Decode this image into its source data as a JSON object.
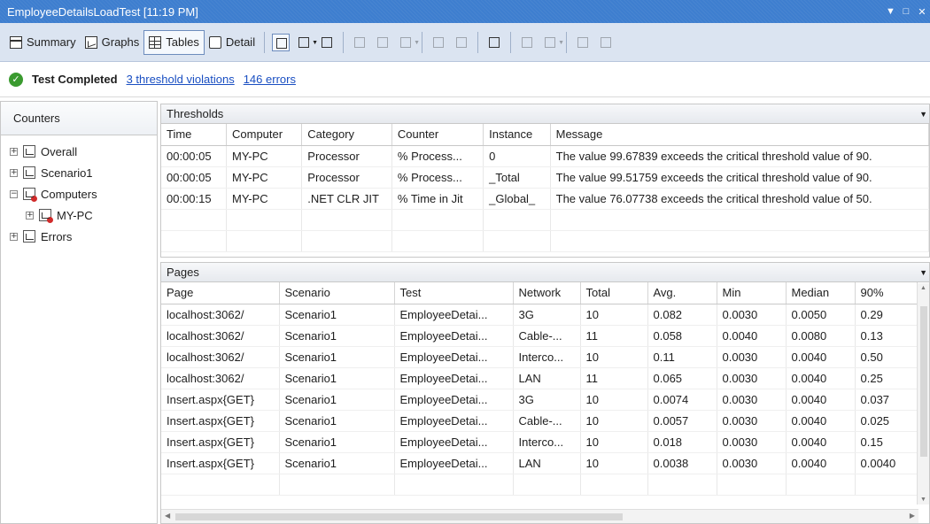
{
  "window": {
    "title": "EmployeeDetailsLoadTest [11:19 PM]"
  },
  "toolbar": {
    "summary_label": "Summary",
    "graphs_label": "Graphs",
    "tables_label": "Tables",
    "detail_label": "Detail"
  },
  "status": {
    "text": "Test Completed",
    "threshold_link": "3 threshold violations",
    "errors_link": "146 errors"
  },
  "counters": {
    "header": "Counters",
    "tree": [
      {
        "label": "Overall",
        "expander": "+"
      },
      {
        "label": "Scenario1",
        "expander": "+"
      },
      {
        "label": "Computers",
        "expander": "−"
      },
      {
        "label": "MY-PC",
        "expander": "+"
      },
      {
        "label": "Errors",
        "expander": "+"
      }
    ]
  },
  "thresholds": {
    "title": "Thresholds",
    "columns": [
      "Time",
      "Computer",
      "Category",
      "Counter",
      "Instance",
      "Message"
    ],
    "rows": [
      [
        "00:00:05",
        "MY-PC",
        "Processor",
        "% Process...",
        "0",
        "The value 99.67839 exceeds the critical threshold value of 90."
      ],
      [
        "00:00:05",
        "MY-PC",
        "Processor",
        "% Process...",
        "_Total",
        "The value 99.51759 exceeds the critical threshold value of 90."
      ],
      [
        "00:00:15",
        "MY-PC",
        ".NET CLR JIT",
        "% Time in Jit",
        "_Global_",
        "The value 76.07738 exceeds the critical threshold value of 50."
      ]
    ]
  },
  "pages": {
    "title": "Pages",
    "columns": [
      "Page",
      "Scenario",
      "Test",
      "Network",
      "Total",
      "Avg.",
      "Min",
      "Median",
      "90%"
    ],
    "rows": [
      [
        "localhost:3062/",
        "Scenario1",
        "EmployeeDetai...",
        "3G",
        "10",
        "0.082",
        "0.0030",
        "0.0050",
        "0.29"
      ],
      [
        "localhost:3062/",
        "Scenario1",
        "EmployeeDetai...",
        "Cable-...",
        "11",
        "0.058",
        "0.0040",
        "0.0080",
        "0.13"
      ],
      [
        "localhost:3062/",
        "Scenario1",
        "EmployeeDetai...",
        "Interco...",
        "10",
        "0.11",
        "0.0030",
        "0.0040",
        "0.50"
      ],
      [
        "localhost:3062/",
        "Scenario1",
        "EmployeeDetai...",
        "LAN",
        "11",
        "0.065",
        "0.0030",
        "0.0040",
        "0.25"
      ],
      [
        "Insert.aspx{GET}",
        "Scenario1",
        "EmployeeDetai...",
        "3G",
        "10",
        "0.0074",
        "0.0030",
        "0.0040",
        "0.037"
      ],
      [
        "Insert.aspx{GET}",
        "Scenario1",
        "EmployeeDetai...",
        "Cable-...",
        "10",
        "0.0057",
        "0.0030",
        "0.0040",
        "0.025"
      ],
      [
        "Insert.aspx{GET}",
        "Scenario1",
        "EmployeeDetai...",
        "Interco...",
        "10",
        "0.018",
        "0.0030",
        "0.0040",
        "0.15"
      ],
      [
        "Insert.aspx{GET}",
        "Scenario1",
        "EmployeeDetai...",
        "LAN",
        "10",
        "0.0038",
        "0.0030",
        "0.0040",
        "0.0040"
      ]
    ]
  }
}
